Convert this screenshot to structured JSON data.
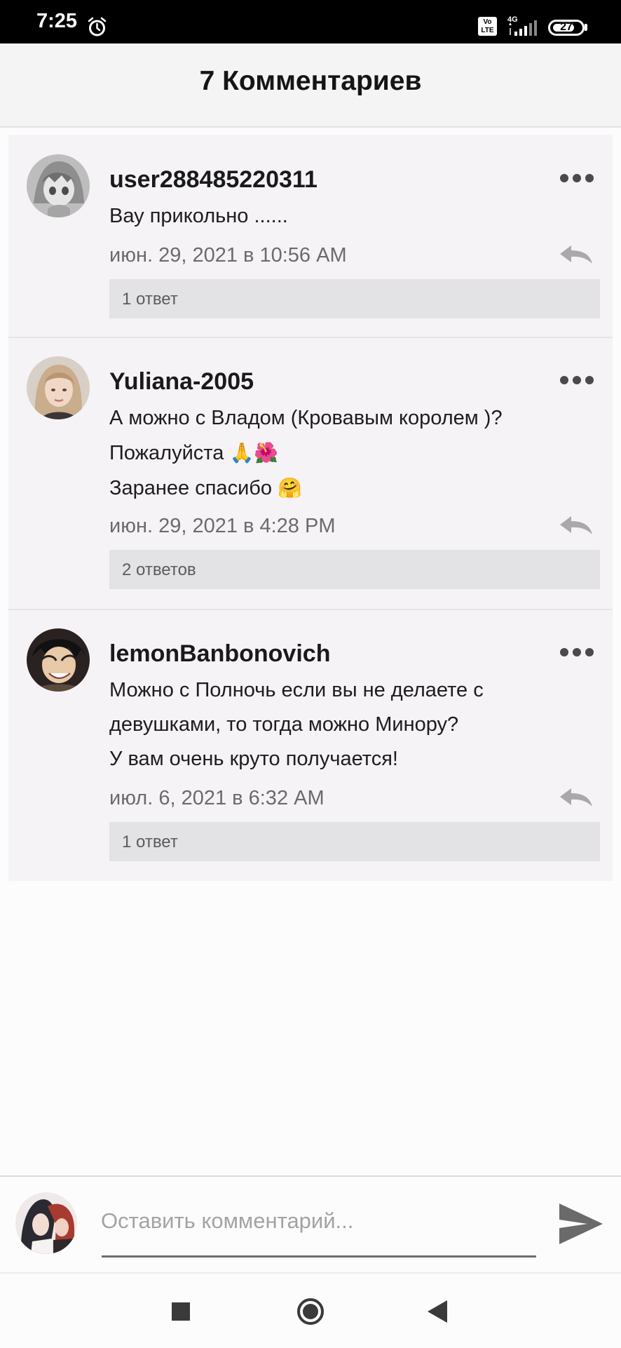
{
  "status_bar": {
    "time": "7:25",
    "volte": "Vo LTE",
    "network": "4G",
    "battery": "27"
  },
  "header": {
    "title": "7 Комментариев"
  },
  "comments": [
    {
      "username": "user288485220311",
      "lines": [
        "Вау прикольно ......"
      ],
      "timestamp": "июн. 29, 2021 в 10:56 AM",
      "replies": "1 ответ"
    },
    {
      "username": "Yuliana-2005",
      "lines": [
        "А можно с Владом (Кровавым королем )?",
        "Пожалуйста",
        "Заранее спасибо"
      ],
      "emoji": [
        "🙏🌺",
        "🤗"
      ],
      "timestamp": "июн. 29, 2021 в 4:28 PM",
      "replies": "2 ответов"
    },
    {
      "username": "lemonBanbonovich",
      "lines": [
        "Можно с Полночь если вы не делаете с",
        "девушками, то тогда можно Минору?",
        "У вам очень круто получается!"
      ],
      "timestamp": "июл. 6, 2021 в 6:32 AM",
      "replies": "1 ответ"
    }
  ],
  "composer": {
    "placeholder": "Оставить комментарий...",
    "send_icon": "send-icon"
  },
  "colors": {
    "header_bg": "#f5f4f5",
    "panel_bg": "#f5f3f6",
    "replies_bg": "#e3e2e4",
    "timestamp": "#6b6b6b"
  }
}
